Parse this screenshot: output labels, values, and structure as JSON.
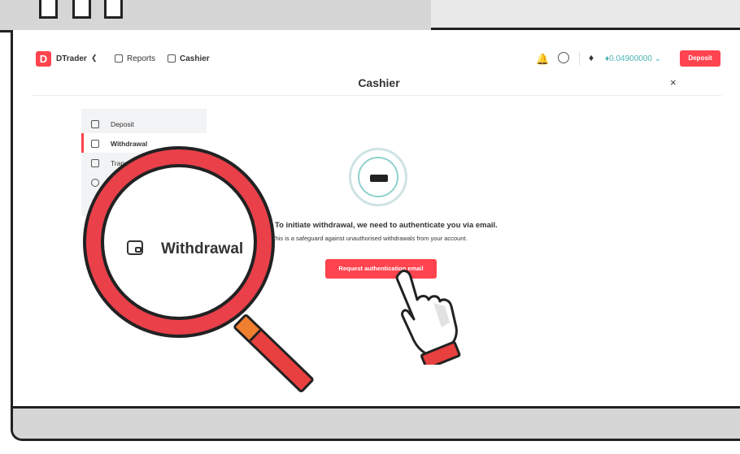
{
  "header": {
    "logo_glyph": "D",
    "app_name": "DTrader",
    "nav": [
      {
        "label": "Reports",
        "icon": "reports-icon"
      },
      {
        "label": "Cashier",
        "icon": "cashier-icon"
      }
    ],
    "balance": "0.04900000",
    "currency_icon": "eth-icon",
    "deposit_label": "Deposit"
  },
  "page": {
    "title": "Cashier",
    "close_glyph": "×"
  },
  "sidebar": {
    "items": [
      {
        "label": "Deposit",
        "icon": "deposit-icon",
        "active": false
      },
      {
        "label": "Withdrawal",
        "icon": "withdrawal-icon",
        "active": true
      },
      {
        "label": "Transfer",
        "icon": "transfer-icon",
        "active": false
      },
      {
        "label": "",
        "icon": "payment-agent-icon",
        "active": false
      }
    ]
  },
  "content": {
    "message_main": "To initiate withdrawal, we need to authenticate you via email.",
    "message_sub": "This is a safeguard against unauthorised withdrawals from your account.",
    "button_label": "Request authentication email"
  },
  "magnifier": {
    "label": "Withdrawal"
  },
  "colors": {
    "brand_red": "#ff444f",
    "balance_teal": "#4bb4b3"
  }
}
